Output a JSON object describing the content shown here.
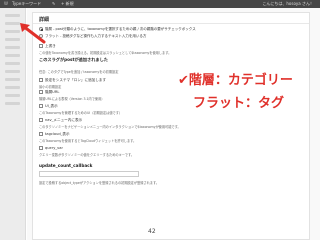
{
  "adminbar": {
    "site": "Typeキーワード",
    "comments": "✎",
    "new": "+ 新規",
    "howdy": "こんにちは、hosoya さん！"
  },
  "panel": {
    "title": "詳細",
    "option1": "階層 - post分類のように、taxonomyを選択するための親 / 次の親階の要がサチェックボックス",
    "option2": "フラット - 投稿タグなど操作も入力するテキスト入力を用いる方",
    "chk1": "上書き",
    "chk1_desc": "この値をTaxonomyを書き換える。初期設定はスラッシュとして$taxonomyを使用します。",
    "heading_slug": "このスラグがpostが追加されました",
    "field_label": "任意: このタグでTypeを追加 / taxonomyをの初期設定",
    "chk2": "設定をシステマ「ロン」に追加します",
    "chk2_desc": "最小の初期設定",
    "chk3": "階層URL",
    "chk3_desc": "階層URLによる表現（Version 3.1内で使用）",
    "chk4": "UI_表示",
    "chk4_desc": "このTaxonomyを管理するためのUI（初期設定は値です）",
    "chk5": "nav_メニュー内に表示",
    "chk5_desc": "このタクソノミーをナビゲーションメニュー内のインタラクションで$taxonomyが使用可能です。",
    "chk6": "tagcloud_表示",
    "chk6_desc": "このTaxonomyを使用するとTagCloudウィジェットを許可します。",
    "chk7": "query_var",
    "chk7_desc": "クエリー変数がタクソノミーの値をクエリーするためのキーです。",
    "heading_callback": "update_count_callback",
    "callback_desc": "設定で投稿するobject_typeがアクションを登録されるの初期設定が登録されます。"
  },
  "annotations": {
    "line1": "✔階層：カテゴリー",
    "line2": "フラット：タグ"
  },
  "page_number": "42"
}
